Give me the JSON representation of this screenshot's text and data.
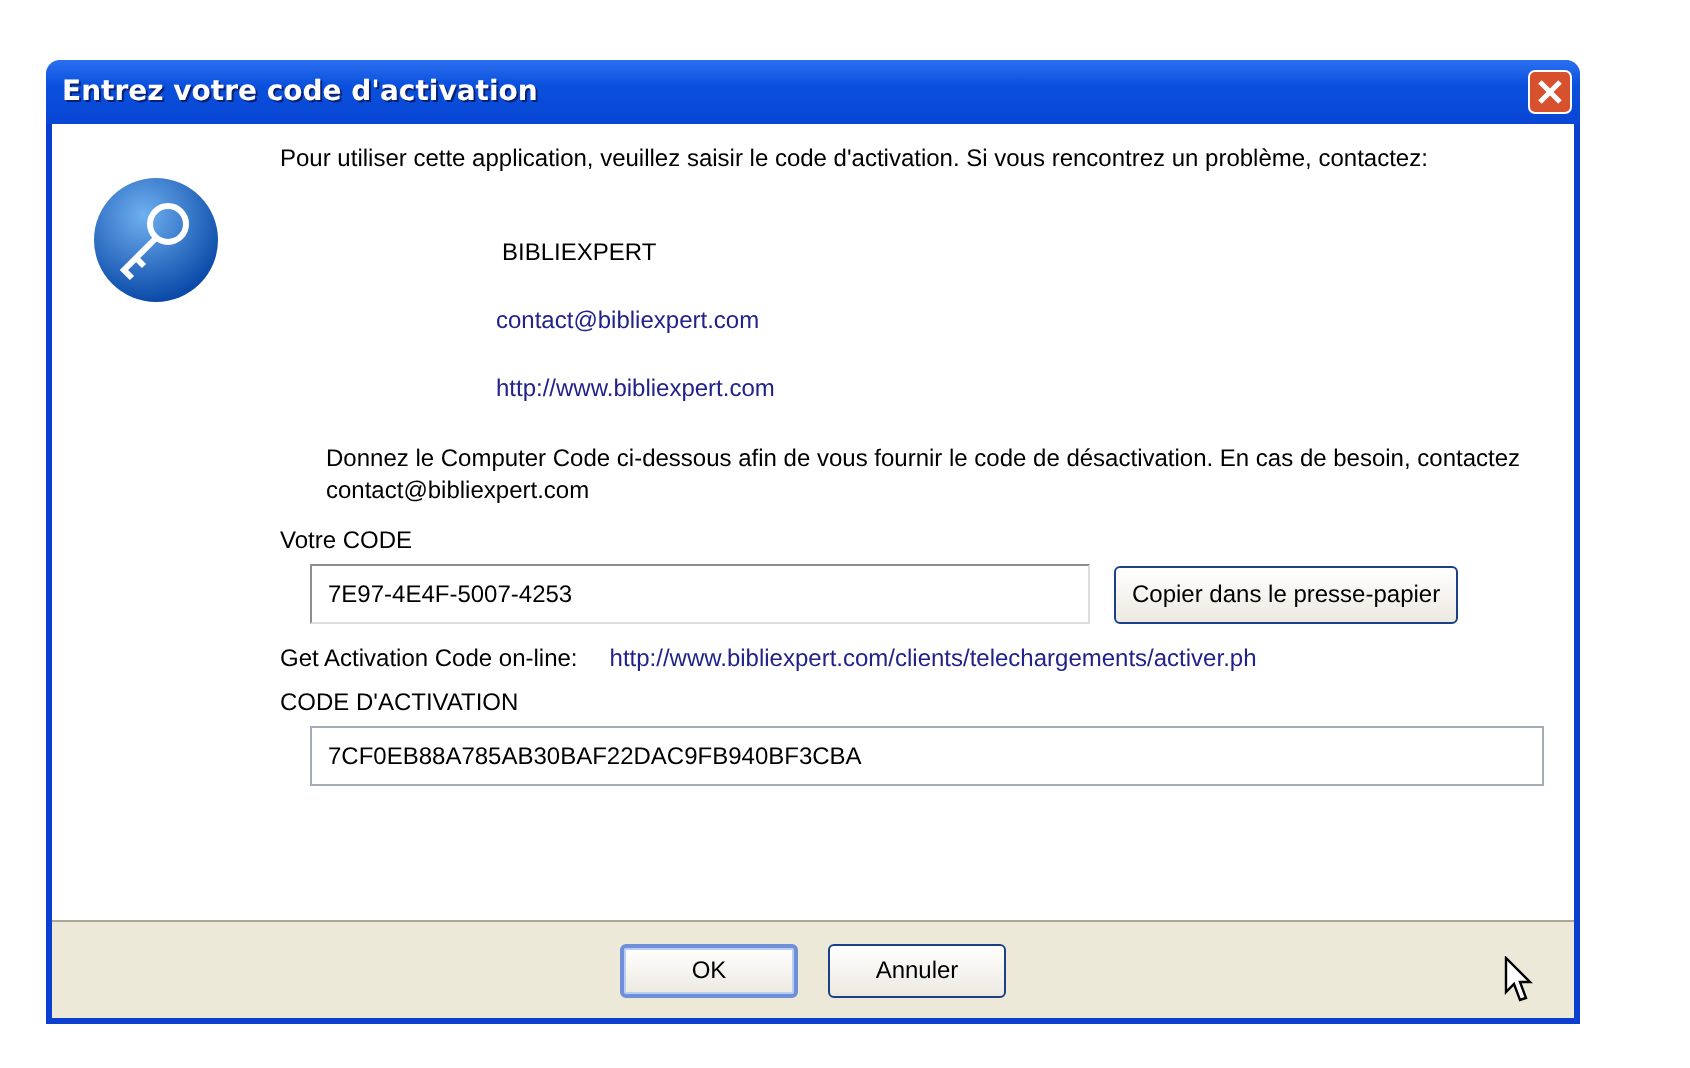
{
  "window": {
    "title": "Entrez votre code d'activation"
  },
  "message": "Pour utiliser cette application, veuillez saisir le code d'activation. Si vous rencontrez un problème, contactez:",
  "contact": {
    "name": "BIBLIEXPERT",
    "email": "contact@bibliexpert.com",
    "website": "http://www.bibliexpert.com"
  },
  "instructions": "Donnez le Computer Code ci-dessous afin de vous fournir le code de désactivation. En cas de besoin, contactez contact@bibliexpert.com",
  "computer_code": {
    "label": "Votre CODE",
    "value": "7E97-4E4F-5007-4253",
    "copy_button": "Copier dans le presse-papier"
  },
  "online": {
    "label": "Get Activation Code on-line:",
    "link": "http://www.bibliexpert.com/clients/telechargements/activer.ph"
  },
  "activation_code": {
    "label": "CODE D'ACTIVATION",
    "value": "7CF0EB88A785AB30BAF22DAC9FB940BF3CBA"
  },
  "buttons": [
    {
      "label": "OK",
      "default": true
    },
    {
      "label": "Annuler",
      "default": false
    }
  ]
}
